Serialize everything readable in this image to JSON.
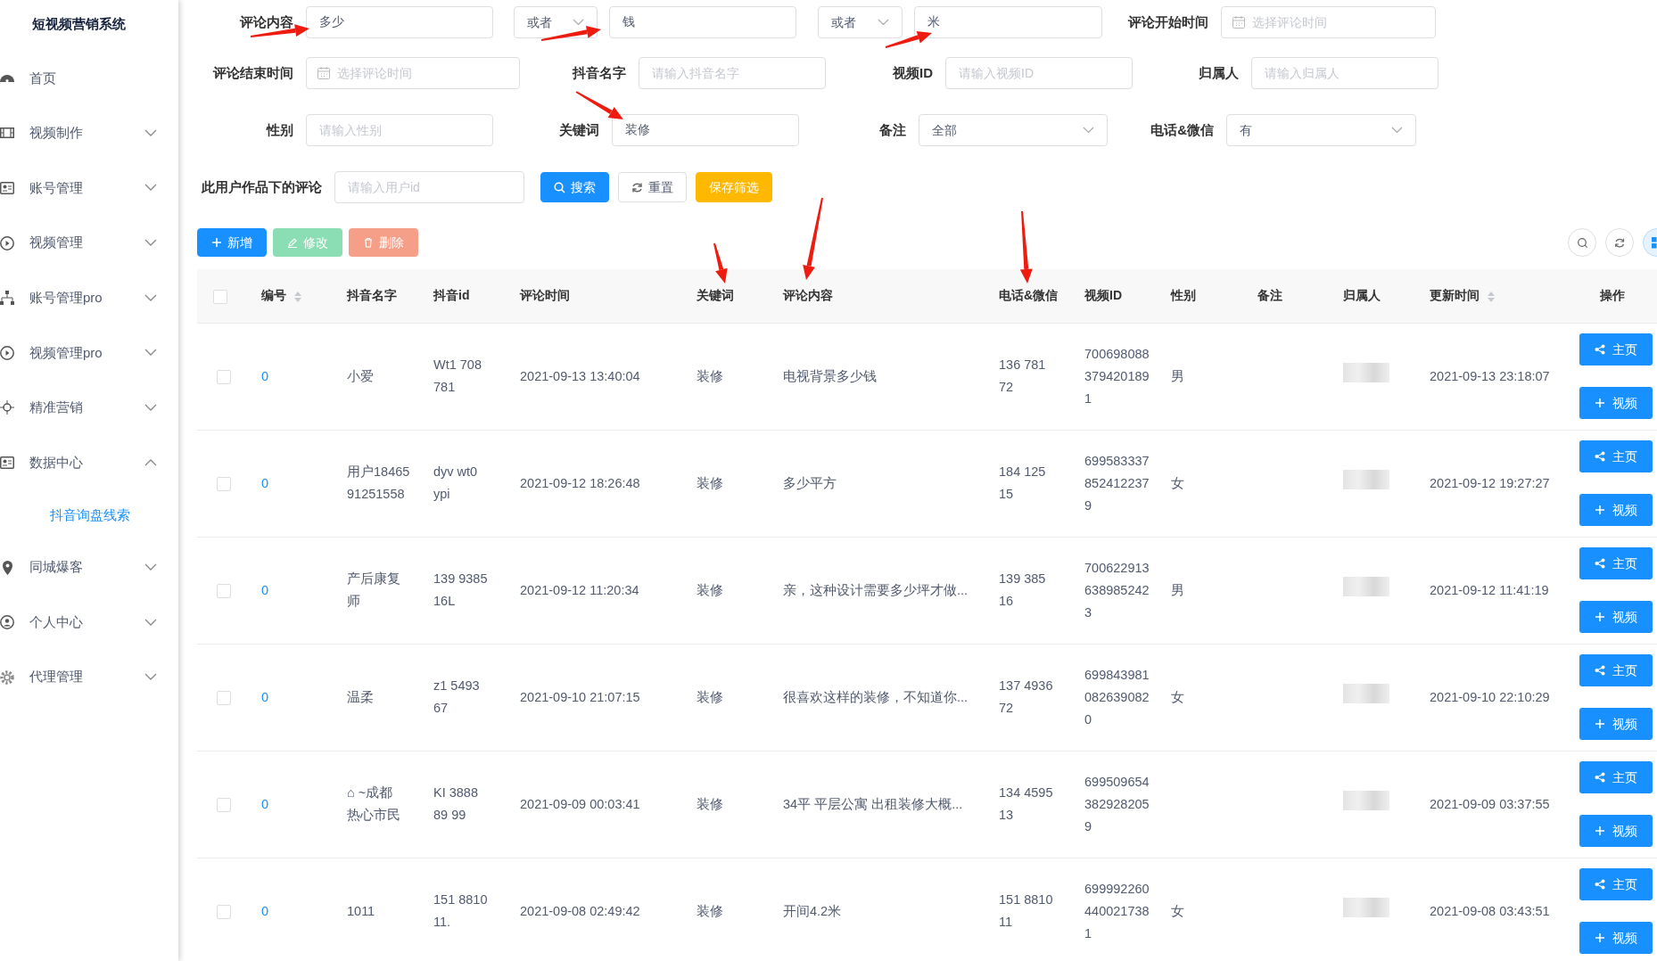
{
  "sidebar": {
    "title": "短视频营销系统",
    "items": [
      {
        "kind": "link",
        "label": "首页"
      },
      {
        "kind": "menu",
        "label": "视频制作",
        "expanded": false
      },
      {
        "kind": "menu",
        "label": "账号管理",
        "expanded": false
      },
      {
        "kind": "menu",
        "label": "视频管理",
        "expanded": false
      },
      {
        "kind": "menu",
        "label": "账号管理pro",
        "expanded": false
      },
      {
        "kind": "menu",
        "label": "视频管理pro",
        "expanded": false
      },
      {
        "kind": "menu",
        "label": "精准营销",
        "expanded": false
      },
      {
        "kind": "menu",
        "label": "数据中心",
        "expanded": true,
        "children": [
          {
            "label": "抖音询盘线索",
            "selected": true
          }
        ]
      },
      {
        "kind": "menu",
        "label": "同城爆客",
        "expanded": false
      },
      {
        "kind": "menu",
        "label": "个人中心",
        "expanded": false
      },
      {
        "kind": "menu",
        "label": "代理管理",
        "expanded": false
      }
    ]
  },
  "filters": [
    [
      {
        "kind": "input",
        "label": "评论内容",
        "value": "多少"
      },
      {
        "kind": "select",
        "value": "或者"
      },
      {
        "kind": "input",
        "value": "钱"
      },
      {
        "kind": "select",
        "value": "或者"
      },
      {
        "kind": "input",
        "value": "米"
      },
      {
        "kind": "date",
        "label": "评论开始时间",
        "placeholder": "选择评论时间"
      }
    ],
    [
      {
        "kind": "date",
        "label": "评论结束时间",
        "placeholder": "选择评论时间"
      },
      {
        "kind": "input",
        "label": "抖音名字",
        "placeholder": "请输入抖音名字"
      },
      {
        "kind": "input",
        "label": "视频ID",
        "placeholder": "请输入视频ID"
      },
      {
        "kind": "input",
        "label": "归属人",
        "placeholder": "请输入归属人"
      }
    ],
    [
      {
        "kind": "input",
        "label": "性别",
        "placeholder": "请输入性别"
      },
      {
        "kind": "input",
        "label": "关键词",
        "value": "装修"
      },
      {
        "kind": "select",
        "label": "备注",
        "value": "全部"
      },
      {
        "kind": "select",
        "label": "电话&微信",
        "value": "有"
      }
    ],
    [
      {
        "kind": "input",
        "label": "此用户作品下的评论",
        "placeholder": "请输入用户id"
      },
      {
        "kind": "button",
        "label": "搜索"
      },
      {
        "kind": "button",
        "label": "重置"
      },
      {
        "kind": "button",
        "label": "保存筛选"
      }
    ]
  ],
  "toolbar": [
    {
      "label": "新增",
      "disabled": false
    },
    {
      "label": "修改",
      "disabled": true
    },
    {
      "label": "删除",
      "disabled": true
    }
  ],
  "tool_icons": [
    {
      "active": false
    },
    {
      "active": false
    },
    {
      "active": true
    }
  ],
  "table": {
    "select_all": false,
    "columns": [
      {
        "label": "编号",
        "sortable": true
      },
      {
        "label": "抖音名字",
        "sortable": false
      },
      {
        "label": "抖音id",
        "sortable": false
      },
      {
        "label": "评论时间",
        "sortable": false
      },
      {
        "label": "关键词",
        "sortable": false
      },
      {
        "label": "评论内容",
        "sortable": false
      },
      {
        "label": "电话&微信",
        "sortable": false
      },
      {
        "label": "视频ID",
        "sortable": false
      },
      {
        "label": "性别",
        "sortable": false
      },
      {
        "label": "备注",
        "sortable": false
      },
      {
        "label": "归属人",
        "sortable": false
      },
      {
        "label": "更新时间",
        "sortable": true
      },
      {
        "label": "操作",
        "sortable": false
      }
    ],
    "rows": [
      {
        "selected": false,
        "cells": [
          "0",
          "小爱",
          "Wt1 708\n781",
          "2021-09-13 13:40:04",
          "装修",
          "电视背景多少钱",
          "136 781\n72",
          "700698088\n379420189\n1",
          "男",
          "",
          "",
          "2021-09-13 23:18:07"
        ],
        "owner_redacted": true,
        "actions": [
          "主页",
          "视频"
        ]
      },
      {
        "selected": false,
        "cells": [
          "0",
          "用户18465\n91251558",
          "dyv wt0\nypi",
          "2021-09-12 18:26:48",
          "装修",
          "多少平方",
          "184 125\n15",
          "699583337\n852412237\n9",
          "女",
          "",
          "",
          "2021-09-12 19:27:27"
        ],
        "owner_redacted": true,
        "actions": [
          "主页",
          "视频"
        ]
      },
      {
        "selected": false,
        "cells": [
          "0",
          "产后康复师",
          "139 9385\n16L",
          "2021-09-12 11:20:34",
          "装修",
          "亲，这种设计需要多少坪才做...",
          "139 385\n16",
          "700622913\n638985242\n3",
          "男",
          "",
          "",
          "2021-09-12 11:41:19"
        ],
        "owner_redacted": true,
        "actions": [
          "主页",
          "视频"
        ]
      },
      {
        "selected": false,
        "cells": [
          "0",
          "温柔",
          "z1 5493\n67",
          "2021-09-10 21:07:15",
          "装修",
          "很喜欢这样的装修，不知道你...",
          "137 4936\n72",
          "699843981\n082639082\n0",
          "女",
          "",
          "",
          "2021-09-10 22:10:29"
        ],
        "owner_redacted": true,
        "actions": [
          "主页",
          "视频"
        ]
      },
      {
        "selected": false,
        "cells": [
          "0",
          "⌂ ~成都热心市民",
          "KI 3888\n89 99",
          "2021-09-09 00:03:41",
          "装修",
          "34平 平层公寓 出租装修大概...",
          "134 4595\n13",
          "699509654\n382928205\n9",
          "",
          "",
          "",
          "2021-09-09 03:37:55"
        ],
        "owner_redacted": true,
        "actions": [
          "主页",
          "视频"
        ]
      },
      {
        "selected": false,
        "cells": [
          "0",
          "1011",
          "151 8810\n11.",
          "2021-09-08 02:49:42",
          "装修",
          "开间4.2米",
          "151 8810\n11",
          "699992260\n440021738\n1",
          "女",
          "",
          "",
          "2021-09-08 03:43:51"
        ],
        "owner_redacted": true,
        "actions": [
          "主页",
          "视频"
        ]
      }
    ]
  }
}
